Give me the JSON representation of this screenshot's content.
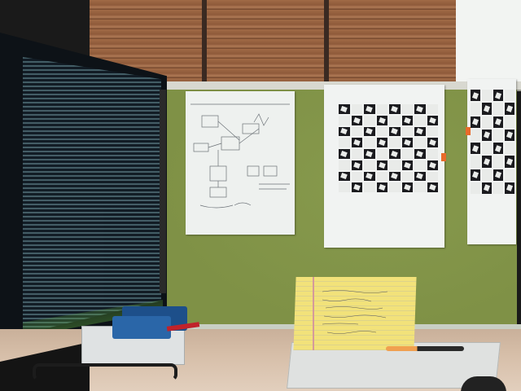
{
  "scene": {
    "description_label": "office cubicle",
    "colors": {
      "wall": "#7f9146",
      "paper": "#f1f3f2",
      "blinds": "#a06a46",
      "legal_pad": "#f2e27a",
      "device_blue": "#2a66a8"
    }
  }
}
